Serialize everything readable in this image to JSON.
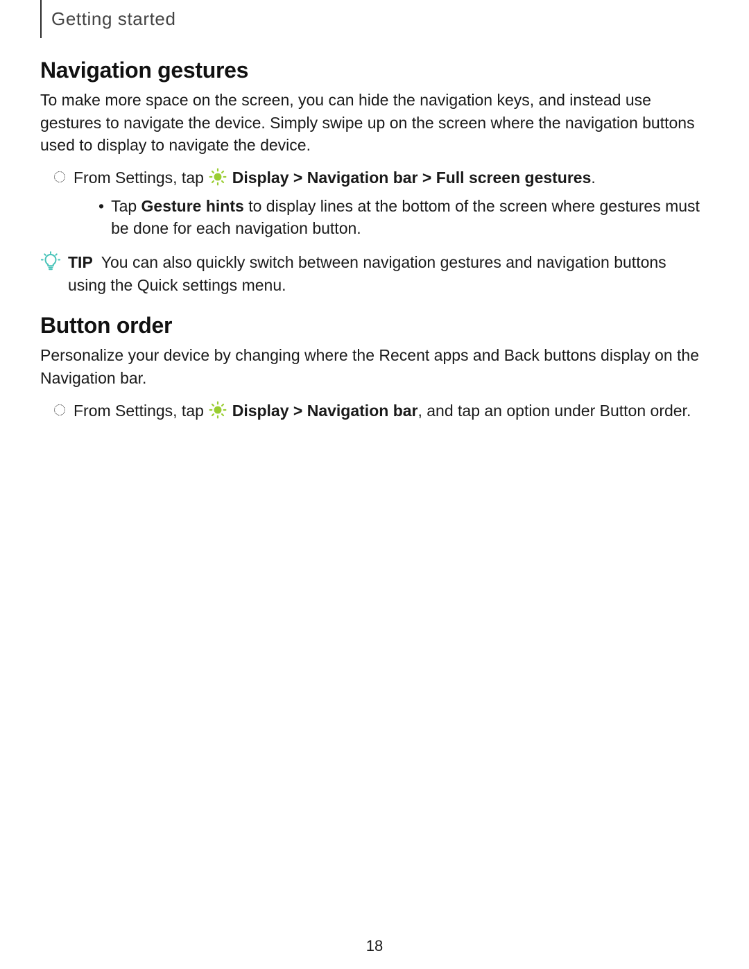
{
  "header": {
    "section": "Getting started"
  },
  "sections": {
    "nav_gestures": {
      "title": "Navigation gestures",
      "intro": "To make more space on the screen, you can hide the navigation keys, and instead use gestures to navigate the device. Simply swipe up on the screen where the navigation buttons used to display to navigate the device.",
      "step_prefix": "From Settings, tap ",
      "step_path_bold": "Display > Navigation bar > Full screen gestures",
      "step_suffix": ".",
      "sub_prefix": "Tap ",
      "sub_bold": "Gesture hints",
      "sub_suffix": " to display lines at the bottom of the screen where gestures must be done for each navigation button."
    },
    "tip": {
      "label": "TIP",
      "text": "You can also quickly switch between navigation gestures and navigation buttons using the Quick settings menu."
    },
    "button_order": {
      "title": "Button order",
      "intro": "Personalize your device by changing where the Recent apps and Back buttons display on the Navigation bar.",
      "step_prefix": "From Settings, tap ",
      "step_path_bold": "Display > Navigation bar",
      "step_suffix": ", and tap an option under Button order."
    }
  },
  "page_number": "18",
  "icons": {
    "sun": "display-brightness-icon",
    "tip": "tip-lightbulb-icon",
    "step_marker": "dotted-circle-icon"
  },
  "colors": {
    "accent": "#9ACD32"
  }
}
